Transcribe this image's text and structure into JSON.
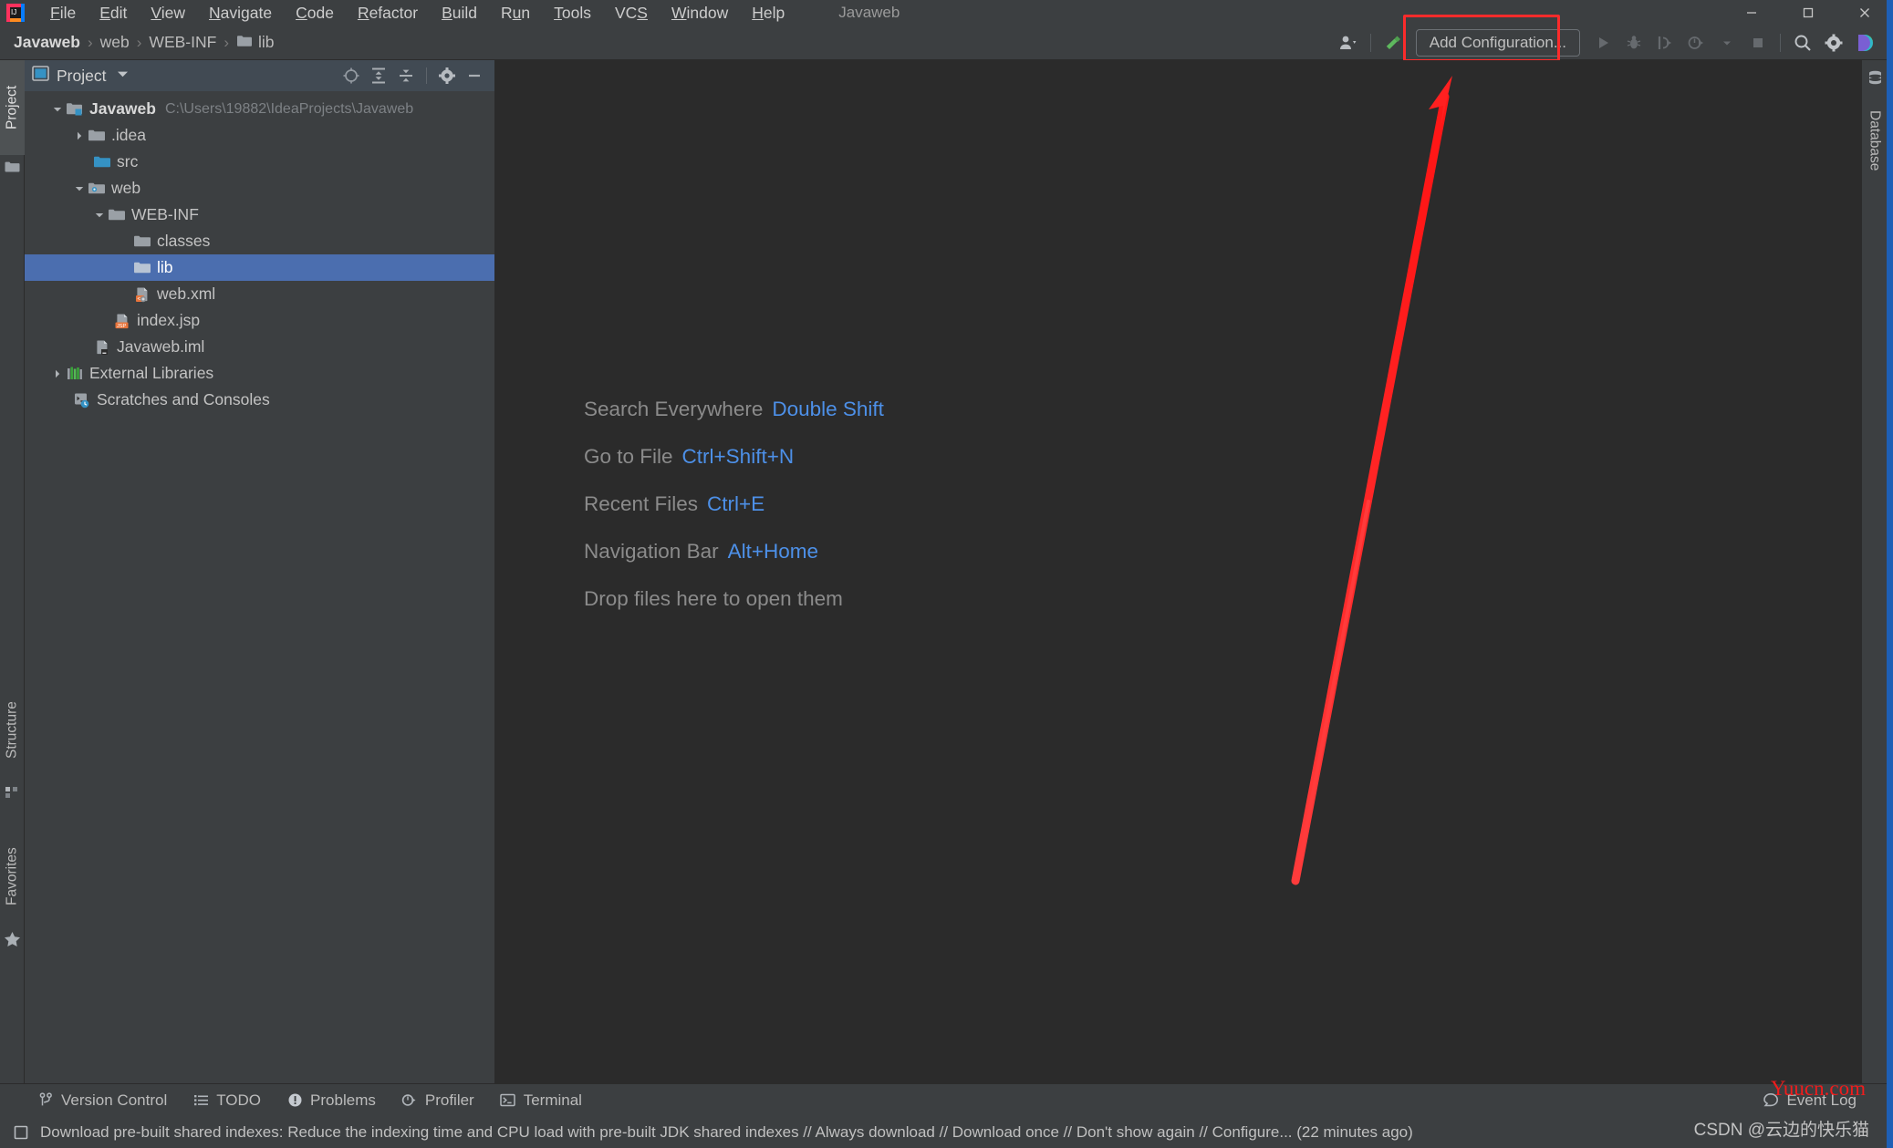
{
  "window": {
    "title": "Javaweb",
    "controls": {
      "minimize": "minimize-icon",
      "maximize": "maximize-icon",
      "close": "close-icon"
    }
  },
  "menu": {
    "items": [
      {
        "label": "File",
        "mnemonic": "F"
      },
      {
        "label": "Edit",
        "mnemonic": "E"
      },
      {
        "label": "View",
        "mnemonic": "V"
      },
      {
        "label": "Navigate",
        "mnemonic": "N"
      },
      {
        "label": "Code",
        "mnemonic": "C"
      },
      {
        "label": "Refactor",
        "mnemonic": "R"
      },
      {
        "label": "Build",
        "mnemonic": "B"
      },
      {
        "label": "Run",
        "mnemonic": "u"
      },
      {
        "label": "Tools",
        "mnemonic": "T"
      },
      {
        "label": "VCS",
        "mnemonic": "S"
      },
      {
        "label": "Window",
        "mnemonic": "W"
      },
      {
        "label": "Help",
        "mnemonic": "H"
      }
    ]
  },
  "navbar": {
    "breadcrumbs": [
      {
        "label": "Javaweb",
        "bold": true,
        "icon": ""
      },
      {
        "label": "web",
        "bold": false,
        "icon": ""
      },
      {
        "label": "WEB-INF",
        "bold": false,
        "icon": ""
      },
      {
        "label": "lib",
        "bold": false,
        "icon": "folder-icon"
      }
    ],
    "separator": "›"
  },
  "toolbar": {
    "user_icon": "user-account-icon",
    "user_caret": "chevron-down-icon",
    "hammer_icon": "build-hammer-icon",
    "add_configuration_label": "Add Configuration...",
    "run_icon": "run-play-icon",
    "debug_icon": "debug-bug-icon",
    "run_coverage_icon": "run-with-coverage-icon",
    "profile_icon": "profiler-icon",
    "profile_caret": "chevron-down-icon",
    "stop_icon": "stop-square-icon",
    "search_icon": "search-icon",
    "settings_icon": "gear-icon",
    "ide_assistant_icon": "datalore-icon",
    "highlight_color": "#fb2b2b"
  },
  "left_strip": {
    "tabs": [
      {
        "label": "Project",
        "icon": "project-folder-icon",
        "active": true
      },
      {
        "label": "Structure",
        "icon": "structure-icon",
        "active": false
      },
      {
        "label": "Favorites",
        "icon": "favorites-star-icon",
        "active": false
      }
    ]
  },
  "right_strip": {
    "tabs": [
      {
        "label": "Database",
        "icon": "database-icon",
        "active": false
      }
    ]
  },
  "project_panel": {
    "title": "Project",
    "view_icon": "project-view-icon",
    "caret": "chevron-down-icon",
    "actions": [
      {
        "name": "select-opened-file",
        "icon": "crosshair-target-icon"
      },
      {
        "name": "expand-all",
        "icon": "expand-all-icon"
      },
      {
        "name": "collapse-all",
        "icon": "collapse-all-icon"
      },
      {
        "name": "settings",
        "icon": "gear-icon"
      },
      {
        "name": "hide",
        "icon": "minimize-icon"
      }
    ],
    "tree": [
      {
        "label": "Javaweb",
        "path": "C:\\Users\\19882\\IdeaProjects\\Javaweb",
        "indent": 0,
        "arrow": "down",
        "icon": "project-root-icon",
        "bold": true,
        "selected": false
      },
      {
        "label": ".idea",
        "path": "",
        "indent": 1,
        "arrow": "right",
        "icon": "folder-icon",
        "bold": false,
        "selected": false
      },
      {
        "label": "src",
        "path": "",
        "indent": 1,
        "arrow": "none",
        "icon": "source-folder-icon",
        "bold": false,
        "selected": false
      },
      {
        "label": "web",
        "path": "",
        "indent": 1,
        "arrow": "down",
        "icon": "web-folder-icon",
        "bold": false,
        "selected": false
      },
      {
        "label": "WEB-INF",
        "path": "",
        "indent": 2,
        "arrow": "down",
        "icon": "folder-icon",
        "bold": false,
        "selected": false
      },
      {
        "label": "classes",
        "path": "",
        "indent": 3,
        "arrow": "none",
        "icon": "folder-icon",
        "bold": false,
        "selected": false
      },
      {
        "label": "lib",
        "path": "",
        "indent": 3,
        "arrow": "none",
        "icon": "folder-icon",
        "bold": false,
        "selected": true
      },
      {
        "label": "web.xml",
        "path": "",
        "indent": 3,
        "arrow": "none",
        "icon": "xml-file-icon",
        "bold": false,
        "selected": false
      },
      {
        "label": "index.jsp",
        "path": "",
        "indent": 2,
        "arrow": "none",
        "icon": "jsp-file-icon",
        "bold": false,
        "selected": false
      },
      {
        "label": "Javaweb.iml",
        "path": "",
        "indent": 1,
        "arrow": "none",
        "icon": "iml-file-icon",
        "bold": false,
        "selected": false
      },
      {
        "label": "External Libraries",
        "path": "",
        "indent": 0,
        "arrow": "right",
        "icon": "libraries-icon",
        "bold": false,
        "selected": false
      },
      {
        "label": "Scratches and Consoles",
        "path": "",
        "indent": 0,
        "arrow": "none",
        "icon": "scratches-icon",
        "bold": false,
        "selected": false
      }
    ]
  },
  "editor": {
    "welcome_lines": [
      {
        "text": "Search Everywhere",
        "shortcut": "Double Shift"
      },
      {
        "text": "Go to File",
        "shortcut": "Ctrl+Shift+N"
      },
      {
        "text": "Recent Files",
        "shortcut": "Ctrl+E"
      },
      {
        "text": "Navigation Bar",
        "shortcut": "Alt+Home"
      },
      {
        "text": "Drop files here to open them",
        "shortcut": ""
      }
    ],
    "shortcut_color": "#4d90e8",
    "text_color": "#8b8b8b"
  },
  "bottom_toolwindows": [
    {
      "label": "Version Control",
      "icon": "branch-icon"
    },
    {
      "label": "TODO",
      "icon": "todo-list-icon"
    },
    {
      "label": "Problems",
      "icon": "problems-warning-icon"
    },
    {
      "label": "Profiler",
      "icon": "profiler-icon"
    },
    {
      "label": "Terminal",
      "icon": "terminal-icon"
    }
  ],
  "status_bar": {
    "icon": "notification-square-icon",
    "message": "Download pre-built shared indexes: Reduce the indexing time and CPU load with pre-built JDK shared indexes // Always download // Download once // Don't show again // Configure... (22 minutes ago)",
    "event_log_label": "Event Log",
    "event_log_icon": "event-log-icon"
  },
  "watermarks": {
    "yuucn": "Yuucn.com",
    "csdn": "CSDN @云边的快乐猫"
  }
}
